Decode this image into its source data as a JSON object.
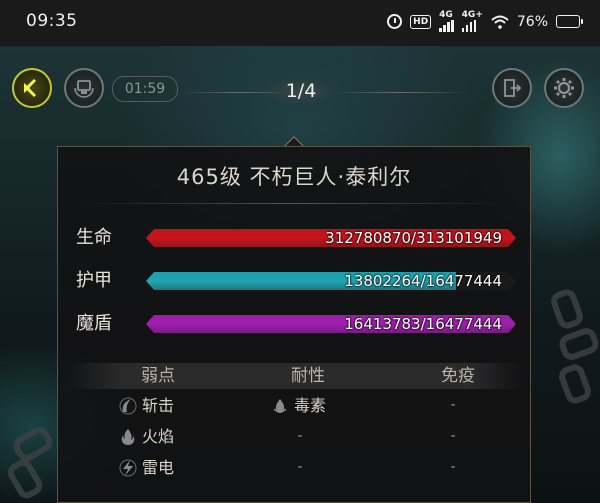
{
  "status_bar": {
    "time": "09:35",
    "hd_label": "HD",
    "network1": "4G",
    "network2": "4G+",
    "battery_percent": "76%",
    "battery_level": 0.76
  },
  "hud": {
    "timer": "01:59",
    "page_counter": "1/4"
  },
  "boss": {
    "title": "465级  不朽巨人·泰利尔"
  },
  "stats": [
    {
      "label": "生命",
      "value_text": "312780870/313101949",
      "current": 312780870,
      "max": 313101949,
      "color": "#c8141c"
    },
    {
      "label": "护甲",
      "value_text": "13802264/16477444",
      "current": 13802264,
      "max": 16477444,
      "color": "#1fa6b3"
    },
    {
      "label": "魔盾",
      "value_text": "16413783/16477444",
      "current": 16413783,
      "max": 16477444,
      "color": "#a21fb0"
    }
  ],
  "resistance": {
    "headers": [
      "弱点",
      "耐性",
      "免疫"
    ],
    "weakness": [
      {
        "label": "斩击",
        "icon": "slash-icon"
      },
      {
        "label": "火焰",
        "icon": "flame-icon"
      },
      {
        "label": "雷电",
        "icon": "lightning-icon"
      }
    ],
    "resist": [
      {
        "label": "毒素",
        "icon": "poison-icon"
      },
      {
        "label": "-"
      },
      {
        "label": "-"
      }
    ],
    "immune": [
      "-",
      "-",
      "-"
    ]
  }
}
